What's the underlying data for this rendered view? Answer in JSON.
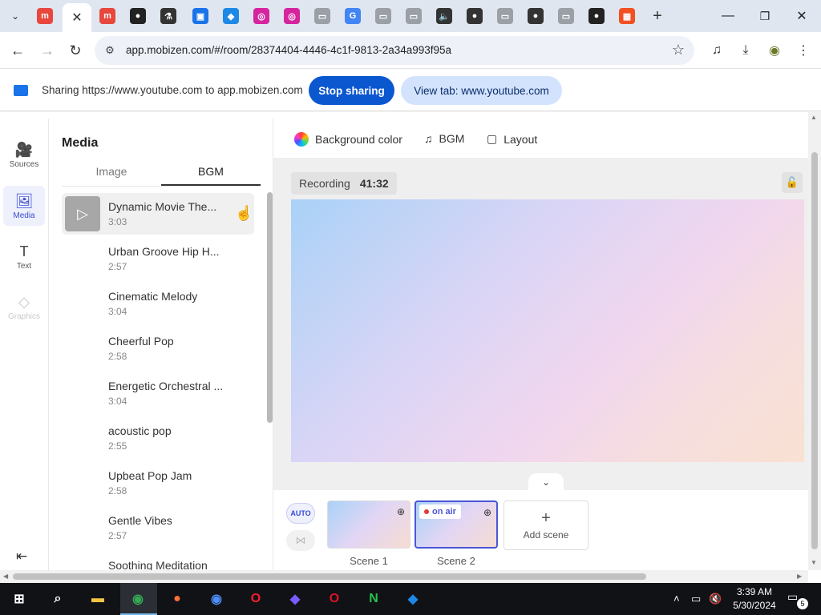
{
  "browser": {
    "tab_search_glyph": "⌄",
    "active_tab_close": "✕",
    "new_tab": "+",
    "window_controls": {
      "minimize": "—",
      "maximize": "❐",
      "close": "✕"
    },
    "tab_icons": [
      {
        "name": "mobizen-tab-icon",
        "glyph": "m",
        "color": "#e8473e"
      },
      {
        "name": "mobizen-tab-icon-2",
        "glyph": "m",
        "color": "#e8473e"
      },
      {
        "name": "github-tab-icon",
        "glyph": "●",
        "color": "#222222"
      },
      {
        "name": "flask-tab-icon",
        "glyph": "⚗",
        "color": "#333333"
      },
      {
        "name": "screen-tab-icon",
        "glyph": "▣",
        "color": "#1a73e8"
      },
      {
        "name": "app-tab-icon",
        "glyph": "◆",
        "color": "#1e88e5"
      },
      {
        "name": "instagram-tab-icon",
        "glyph": "◎",
        "color": "#d6249f"
      },
      {
        "name": "instagram-tab-icon-2",
        "glyph": "◎",
        "color": "#d6249f"
      },
      {
        "name": "doc-tab-icon",
        "glyph": "▭",
        "color": "#9aa0a6"
      },
      {
        "name": "google-tab-icon",
        "glyph": "G",
        "color": "#4285f4"
      },
      {
        "name": "doc-tab-icon-2",
        "glyph": "▭",
        "color": "#9aa0a6"
      },
      {
        "name": "doc-tab-icon-3",
        "glyph": "▭",
        "color": "#9aa0a6"
      },
      {
        "name": "speaker-tab-icon",
        "glyph": "🔈",
        "color": "#333333"
      },
      {
        "name": "profile-tab-icon",
        "glyph": "●",
        "color": "#333333"
      },
      {
        "name": "doc-tab-icon-4",
        "glyph": "▭",
        "color": "#9aa0a6"
      },
      {
        "name": "profile-tab-icon-2",
        "glyph": "●",
        "color": "#333333"
      },
      {
        "name": "doc-tab-icon-5",
        "glyph": "▭",
        "color": "#9aa0a6"
      },
      {
        "name": "github-tab-icon-2",
        "glyph": "●",
        "color": "#222222"
      },
      {
        "name": "microsoft-tab-icon",
        "glyph": "▦",
        "color": "#f25022"
      }
    ],
    "url": "app.mobizen.com/#/room/28374404-4446-4c1f-9813-2a34a993f95a",
    "nav": {
      "back": "←",
      "forward": "→",
      "reload": "↻",
      "site_info": "⚙",
      "bookmark": "☆"
    },
    "toolbar_icons": {
      "media": "♫",
      "download": "⤓",
      "extension": "◉",
      "menu": "⋮"
    }
  },
  "sharing": {
    "message": "Sharing https://www.youtube.com to app.mobizen.com",
    "stop_label": "Stop sharing",
    "view_label": "View tab: www.youtube.com"
  },
  "sidenav": {
    "items": [
      {
        "label": "Sources",
        "icon": "🎥"
      },
      {
        "label": "Media",
        "icon": "🖼"
      },
      {
        "label": "Text",
        "icon": "T"
      },
      {
        "label": "Graphics",
        "icon": "◇"
      }
    ],
    "collapse_glyph": "⇤"
  },
  "media": {
    "title": "Media",
    "tabs": [
      "Image",
      "BGM"
    ],
    "play_glyph": "▷",
    "cursor_glyph": "☝",
    "tracks": [
      {
        "name": "Dynamic Movie The...",
        "duration": "3:03"
      },
      {
        "name": "Urban Groove Hip H...",
        "duration": "2:57"
      },
      {
        "name": "Cinematic Melody",
        "duration": "3:04"
      },
      {
        "name": "Cheerful Pop",
        "duration": "2:58"
      },
      {
        "name": "Energetic Orchestral ...",
        "duration": "3:04"
      },
      {
        "name": "acoustic pop",
        "duration": "2:55"
      },
      {
        "name": "Upbeat Pop Jam",
        "duration": "2:58"
      },
      {
        "name": "Gentle Vibes",
        "duration": "2:57"
      },
      {
        "name": "Soothing Meditation",
        "duration": ""
      }
    ]
  },
  "stage": {
    "tools": {
      "background_color": "Background color",
      "bgm": "BGM",
      "bgm_icon": "♫",
      "layout": "Layout",
      "layout_icon": "▢"
    },
    "recording_label": "Recording",
    "recording_time": "41:32",
    "lock_glyph": "🔓",
    "chevron_glyph": "⌄"
  },
  "scenes": {
    "auto_label": "AUTO",
    "transition_glyph": "⋈",
    "zoom_glyph": "⊕",
    "on_air_label": "on air",
    "items": [
      {
        "label": "Scene 1"
      },
      {
        "label": "Scene 2"
      }
    ],
    "add_glyph": "+",
    "add_label": "Add scene"
  },
  "taskbar": {
    "time": "3:39 AM",
    "date": "5/30/2024",
    "notification_count": "5",
    "apps": [
      {
        "name": "windows-start-icon",
        "glyph": "⊞",
        "color": "#ffffff"
      },
      {
        "name": "search-icon",
        "glyph": "⌕",
        "color": "#ffffff"
      },
      {
        "name": "file-explorer-icon",
        "glyph": "▬",
        "color": "#f4c542"
      },
      {
        "name": "chrome-icon",
        "glyph": "◉",
        "color": "#34a853"
      },
      {
        "name": "firefox-icon",
        "glyph": "●",
        "color": "#ff7139"
      },
      {
        "name": "chromium-icon",
        "glyph": "◉",
        "color": "#4f8ef7"
      },
      {
        "name": "opera-icon",
        "glyph": "O",
        "color": "#ff1b2d"
      },
      {
        "name": "purple-app-icon",
        "glyph": "◆",
        "color": "#7b5cff"
      },
      {
        "name": "opera-gx-icon",
        "glyph": "O",
        "color": "#e0112b"
      },
      {
        "name": "n-app-icon",
        "glyph": "N",
        "color": "#27c24c"
      },
      {
        "name": "blue-app-icon",
        "glyph": "◆",
        "color": "#1e88e5"
      }
    ],
    "tray": {
      "chevron": "˄",
      "network": "▭",
      "volume": "🔇"
    }
  }
}
